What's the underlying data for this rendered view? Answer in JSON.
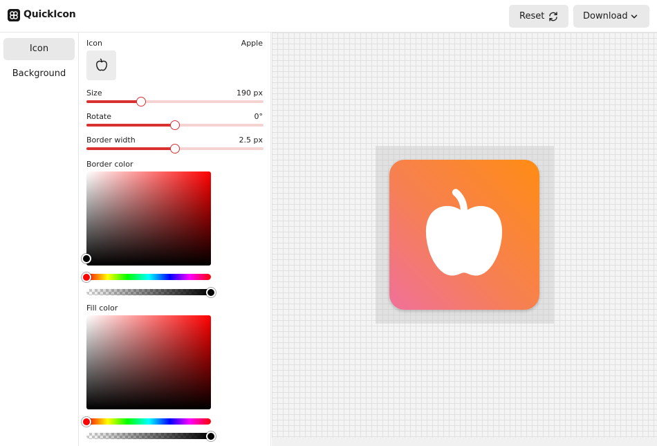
{
  "app": {
    "title": "QuickIcon",
    "logo_icon": "app-logo-icon"
  },
  "header": {
    "reset_label": "Reset",
    "reset_icon": "refresh-icon",
    "download_label": "Download",
    "download_icon": "chevron-down-icon"
  },
  "nav": {
    "items": [
      {
        "label": "Icon",
        "active": true
      },
      {
        "label": "Background",
        "active": false
      }
    ]
  },
  "panel": {
    "icon": {
      "label": "Icon",
      "name": "Apple",
      "icon": "apple-icon"
    },
    "size": {
      "label": "Size",
      "value": "190 px",
      "fraction": 0.31
    },
    "rotate": {
      "label": "Rotate",
      "value": "0°",
      "fraction": 0.5
    },
    "border_width": {
      "label": "Border width",
      "value": "2.5 px",
      "fraction": 0.5
    },
    "border_color": {
      "label": "Border color",
      "hue": "#ff0000",
      "selected": "#000000",
      "alpha": 1
    },
    "fill_color": {
      "label": "Fill color",
      "hue": "#ff0000",
      "alpha": 1
    }
  },
  "canvas": {
    "gradient_start": "#ff8c14",
    "gradient_end": "#f0709a",
    "glyph_color": "#ffffff"
  }
}
